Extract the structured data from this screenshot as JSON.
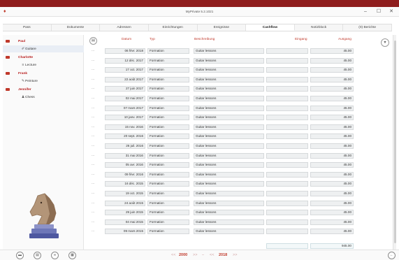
{
  "window": {
    "title": "MyPrivate 5.2.1021",
    "minimize": "–",
    "maximize": "☐",
    "close": "✕"
  },
  "tabs": [
    "Pass",
    "Dokumente",
    "Adressen",
    "Einrichtungen",
    "Ereignisse",
    "Cashflow",
    "Notizblock",
    "(0) Berichte"
  ],
  "active_tab": "Cashflow",
  "tree": {
    "people": [
      {
        "name": "Paul",
        "hobbies": [
          {
            "name": "Guitare",
            "icon": "guitar-icon"
          }
        ]
      },
      {
        "name": "Charlotte",
        "hobbies": [
          {
            "name": "Lecture",
            "icon": "book-icon"
          }
        ]
      },
      {
        "name": "Frank",
        "hobbies": [
          {
            "name": "Peinture",
            "icon": "paint-icon"
          }
        ]
      },
      {
        "name": "Jennifer",
        "hobbies": [
          {
            "name": "Chess",
            "icon": "chess-pawn-icon"
          }
        ]
      }
    ]
  },
  "columns": {
    "datum": "Datum",
    "typ": "Typ",
    "beschreibung": "Beschreibung",
    "eingang": "Eingang",
    "ausgang": "Ausgang"
  },
  "rows": [
    {
      "date": "06 févr. 2018",
      "typ": "Formation",
      "desc": "Guitar lessons",
      "in": "",
      "out": "45.00"
    },
    {
      "date": "12 déc. 2017",
      "typ": "Formation",
      "desc": "Guitar lessons",
      "in": "",
      "out": "45.00"
    },
    {
      "date": "17 oct. 2017",
      "typ": "Formation",
      "desc": "Guitar lessons",
      "in": "",
      "out": "45.00"
    },
    {
      "date": "22 août 2017",
      "typ": "Formation",
      "desc": "Guitar lessons",
      "in": "",
      "out": "45.00"
    },
    {
      "date": "27 juin 2017",
      "typ": "Formation",
      "desc": "Guitar lessons",
      "in": "",
      "out": "45.00"
    },
    {
      "date": "02 mai 2017",
      "typ": "Formation",
      "desc": "Guitar lessons",
      "in": "",
      "out": "45.00"
    },
    {
      "date": "07 mars 2017",
      "typ": "Formation",
      "desc": "Guitar lessons",
      "in": "",
      "out": "45.00"
    },
    {
      "date": "10 janv. 2017",
      "typ": "Formation",
      "desc": "Guitar lessons",
      "in": "",
      "out": "45.00"
    },
    {
      "date": "15 nov. 2016",
      "typ": "Formation",
      "desc": "Guitar lessons",
      "in": "",
      "out": "45.00"
    },
    {
      "date": "20 sept. 2016",
      "typ": "Formation",
      "desc": "Guitar lessons",
      "in": "",
      "out": "45.00"
    },
    {
      "date": "26 juil. 2016",
      "typ": "Formation",
      "desc": "Guitar lessons",
      "in": "",
      "out": "45.00"
    },
    {
      "date": "31 mai 2016",
      "typ": "Formation",
      "desc": "Guitar lessons",
      "in": "",
      "out": "45.00"
    },
    {
      "date": "05 avr. 2016",
      "typ": "Formation",
      "desc": "Guitar lessons",
      "in": "",
      "out": "45.00"
    },
    {
      "date": "09 févr. 2016",
      "typ": "Formation",
      "desc": "Guitar lessons",
      "in": "",
      "out": "45.00"
    },
    {
      "date": "16 déc. 2015",
      "typ": "Formation",
      "desc": "Guitar lessons",
      "in": "",
      "out": "45.00"
    },
    {
      "date": "19 oct. 2015",
      "typ": "Formation",
      "desc": "Guitar lessons",
      "in": "",
      "out": "45.00"
    },
    {
      "date": "24 août 2015",
      "typ": "Formation",
      "desc": "Guitar lessons",
      "in": "",
      "out": "45.00"
    },
    {
      "date": "29 juin 2015",
      "typ": "Formation",
      "desc": "Guitar lessons",
      "in": "",
      "out": "45.00"
    },
    {
      "date": "04 mai 2015",
      "typ": "Formation",
      "desc": "Guitar lessons",
      "in": "",
      "out": "45.00"
    },
    {
      "date": "09 mars 2015",
      "typ": "Formation",
      "desc": "Guitar lessons",
      "in": "",
      "out": "45.00"
    }
  ],
  "totals": {
    "in": "",
    "out": "945.00"
  },
  "row_action": "...",
  "year_nav": {
    "prev": "<<",
    "from_year": "2000",
    "forward": ">>",
    "dash": "–",
    "back": "<<",
    "to_year": "2018",
    "next": ">>"
  },
  "colors": {
    "accent": "#c0392b",
    "topbar": "#8f1d1d"
  }
}
